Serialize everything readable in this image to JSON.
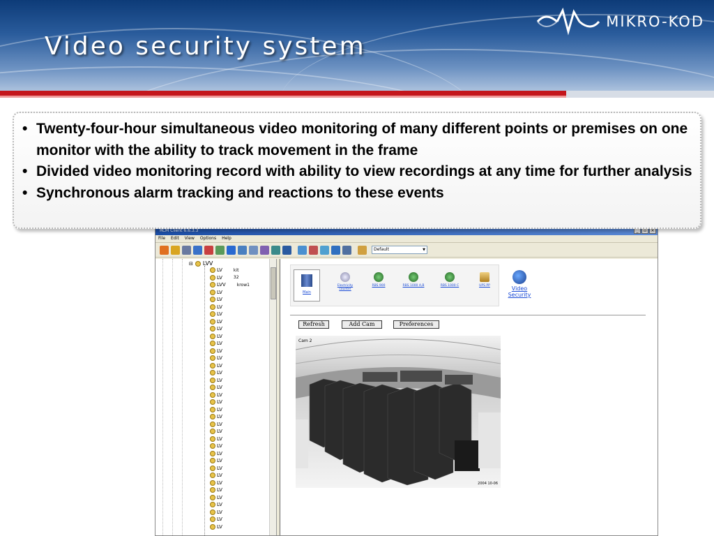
{
  "slide": {
    "title": "Video security system",
    "brand": "MIKRO-KOD"
  },
  "bullets": [
    "Twenty-four-hour simultaneous video monitoring of many different points or premises on one monitor with the ability to track movement in the frame",
    "Divided video monitoring record with ability to view recordings at any time for further analysis",
    "Synchronous alarm tracking and reactions to these events"
  ],
  "app": {
    "window_title": "RCM Client 6.6.3.3",
    "menu": [
      "File",
      "Edit",
      "View",
      "Options",
      "Help"
    ],
    "profile_select": "Default",
    "tree": {
      "root": "LVV",
      "nodes": [
        "LV",
        "LV",
        "LVV",
        "LV",
        "LV",
        "LV",
        "LV",
        "LV",
        "LV",
        "LV",
        "LV",
        "LV",
        "LV",
        "LV",
        "LV",
        "LV",
        "LV",
        "LV",
        "LV",
        "LV",
        "LV",
        "LV",
        "LV",
        "LV",
        "LV",
        "LV",
        "LV",
        "LV",
        "LV",
        "LV",
        "LV",
        "LV",
        "LV",
        "LV",
        "LV",
        "LV"
      ],
      "notes": {
        "n0": "kit",
        "n1": "32",
        "n2": "krow1"
      }
    },
    "devices": {
      "main": "Main",
      "electricity": "Electricity counter",
      "rbs900": "RBS 900",
      "rbs1000ab": "RBS 1000 A,B",
      "rbs1000c": "RBS 1000 C",
      "ups": "UPS PP",
      "video_security": "Video Security"
    },
    "buttons": {
      "refresh": "Refresh",
      "add_cam": "Add Cam",
      "preferences": "Preferences"
    },
    "camera": {
      "label": "Cam 2",
      "timestamp": "2004 10-06"
    }
  },
  "colors": {
    "banner_dark": "#0d3b78",
    "accent_red": "#c4161c",
    "link_blue": "#1a4bd6"
  }
}
